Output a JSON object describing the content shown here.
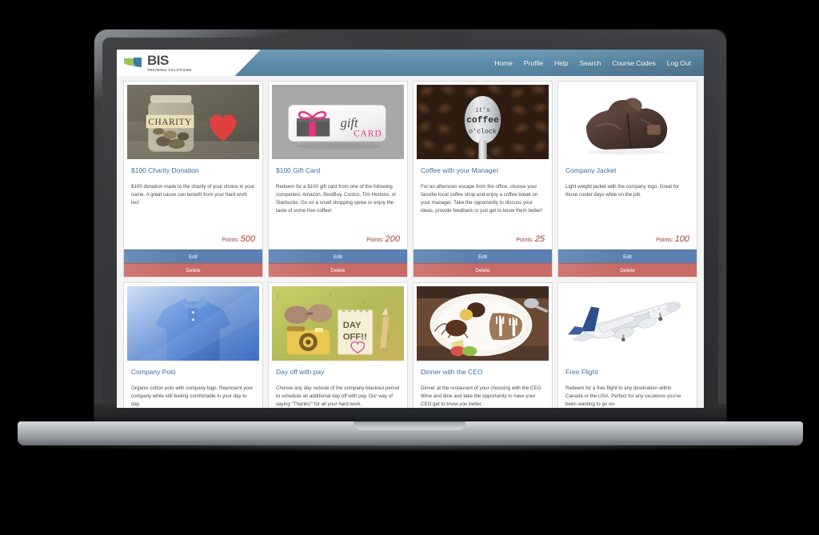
{
  "header": {
    "logo": {
      "name": "BIS",
      "tagline": "TRAINING SOLUTIONS",
      "green": "#9ac45a",
      "blue": "#3b7ea8"
    },
    "nav": [
      {
        "label": "Home",
        "name": "nav-home"
      },
      {
        "label": "Profile",
        "name": "nav-profile"
      },
      {
        "label": "Help",
        "name": "nav-help"
      },
      {
        "label": "Search",
        "name": "nav-search"
      },
      {
        "label": "Course Codes",
        "name": "nav-course-codes"
      },
      {
        "label": "Log Out",
        "name": "nav-log-out"
      }
    ],
    "bar_color": "#5d8cab"
  },
  "buttons": {
    "edit_label": "Edit",
    "delete_label": "Delete",
    "edit_color": "#5b81b0",
    "delete_color": "#c96a66"
  },
  "points_label": "Points:",
  "cards": [
    {
      "title": "$100 Charity Donation",
      "description": "$100 donation made to the charity of your choice in your name. A great cause can benefit from your hard work too!",
      "points": "500",
      "image_name": "charity-jar-with-heart-image"
    },
    {
      "title": "$100 Gift Card",
      "description": "Redeem for a $100 gift card from one of the following companies: Amazon, BestBuy, Costco, Tim Hortons, or Starbucks. Go on a small shopping spree or enjoy the taste of some free coffee!",
      "points": "200",
      "image_name": "gift-card-image"
    },
    {
      "title": "Coffee with your Manager",
      "description": "For an afternoon escape from the office, choose your favorite local coffee shop and enjoy a coffee break on your manager. Take the opportunity to discuss your ideas, provide feedback or just get to know them better!",
      "points": "25",
      "image_name": "coffee-beans-spoon-image"
    },
    {
      "title": "Company Jacket",
      "description": "Light weight jacket with the company logo. Great for those cooler days while on the job.",
      "points": "100",
      "image_name": "brown-jacket-image"
    },
    {
      "title": "Company Polo",
      "description": "Organic cotton polo with company logo. Represent your company while still feeling comfortable in your day to day.",
      "points": "",
      "image_name": "blue-polo-shirt-image"
    },
    {
      "title": "Day off with pay",
      "description": "Choose any day outside of the company blackout period to schedule an additional day off with pay. Our way of saying \"Thanks!\" for all your hard work.",
      "points": "",
      "image_name": "day-off-notepad-image"
    },
    {
      "title": "Dinner with the CEO",
      "description": "Dinner at the restaurant of your choosing with the CEO. Wine and dine and take the opportunity to have your CEO get to know you better.",
      "points": "",
      "image_name": "dessert-plate-image"
    },
    {
      "title": "Free Flight",
      "description": "Redeem for a free flight to any destination within Canada or the USA. Perfect for any vacations you've been wanting to go on.",
      "points": "",
      "image_name": "airplane-image"
    }
  ],
  "image_text": {
    "charity_label": "CHARITY",
    "gift_word": "gift",
    "card_word": "CARD",
    "coffee_line1": "it's",
    "coffee_line2": "coffee",
    "coffee_line3": "o'clock",
    "dayoff_line1": "DAY",
    "dayoff_line2": "OFF!!"
  }
}
